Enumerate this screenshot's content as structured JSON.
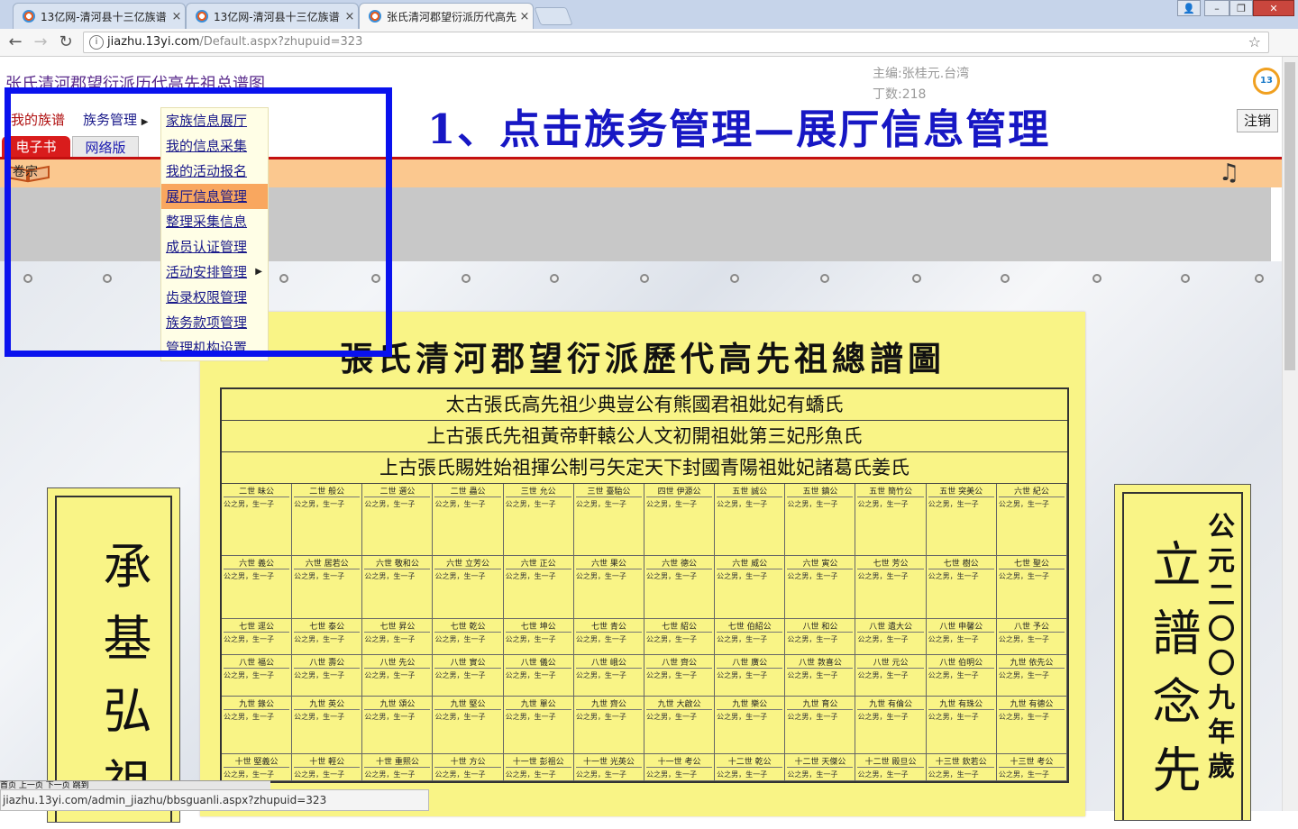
{
  "browser": {
    "tabs": [
      {
        "title": "13亿网-清河县十三亿族谱"
      },
      {
        "title": "13亿网-清河县十三亿族谱"
      },
      {
        "title": "张氏清河郡望衍派历代高先"
      }
    ],
    "tab_close": "×",
    "window_buttons": [
      "👤",
      "–",
      "❐",
      "✕"
    ],
    "address": {
      "host": "jiazhu.13yi.com",
      "path": "/Default.aspx?zhupuid=323"
    },
    "status_url": "jiazhu.13yi.com/admin_jiazhu/bbsguanli.aspx?zhupuid=323"
  },
  "page": {
    "site_title": "张氏清河郡望衍派历代高先祖总谱图",
    "editor": "主编:张桂元.台湾",
    "ding": "丁数:218",
    "logo_text": "13",
    "logout": "注销",
    "heading": "1、点击族务管理—展厅信息管理",
    "menu": {
      "my_clan": "我的族谱",
      "clan_affairs": "族务管理"
    },
    "tabs": {
      "ebook": "电子书",
      "web": "网络版"
    },
    "tiao_label": "卷宗",
    "dropdown": [
      "家族信息展厅",
      "我的信息采集",
      "我的活动报名",
      "展厅信息管理",
      "整理采集信息",
      "成员认证管理",
      "活动安排管理",
      "齿录权限管理",
      "族务款项管理",
      "管理机构设置"
    ],
    "dropdown_selected": 3,
    "pager": "首页 上一页 下一页 跳到"
  },
  "poster": {
    "title": "張氏清河郡望衍派歷代高先祖總譜圖",
    "banners": [
      "太古張氏高先祖少典豈公有熊國君祖妣妃有蟜氏",
      "上古張氏先祖黃帝軒轅公人文初開祖妣第三妃彤魚氏",
      "上古張氏賜姓始祖揮公制弓矢定天下封國青陽祖妣妃諸葛氏姜氏"
    ],
    "rows": [
      [
        "二世 昧公",
        "二世 般公",
        "二世 選公",
        "二世 蟲公",
        "三世 允公",
        "三世 臺駘公",
        "四世 伊源公",
        "五世 誠公",
        "五世 鎮公",
        "五世 簡竹公",
        "五世 突美公",
        "六世 紀公"
      ],
      [
        "六世 義公",
        "六世 居若公",
        "六世 敬和公",
        "六世 立芳公",
        "六世 正公",
        "六世 果公",
        "六世 德公",
        "六世 威公",
        "六世 寅公",
        "七世 芳公",
        "七世 樹公",
        "七世 聖公"
      ],
      [
        "七世 逕公",
        "七世 泰公",
        "七世 昇公",
        "七世 乾公",
        "七世 坤公",
        "七世 青公",
        "七世 紹公",
        "七世 伯紹公",
        "八世 和公",
        "八世 遺大公",
        "八世 申馨公",
        "八世 予公"
      ],
      [
        "八世 福公",
        "八世 壽公",
        "八世 先公",
        "八世 實公",
        "八世 儀公",
        "八世 峨公",
        "八世 齊公",
        "八世 廣公",
        "八世 敦喜公",
        "八世 元公",
        "八世 伯明公",
        "九世 依先公"
      ],
      [
        "九世 錄公",
        "九世 英公",
        "九世 頌公",
        "九世 堅公",
        "九世 單公",
        "九世 齊公",
        "九世 大啟公",
        "九世 樂公",
        "九世 育公",
        "九世 有倫公",
        "九世 有珠公",
        "九世 有德公"
      ],
      [
        "十世 堅義公",
        "十世 輕公",
        "十世 重熙公",
        "十世 方公",
        "十一世 彭祖公",
        "十一世 光英公",
        "十一世 考公",
        "十二世 乾公",
        "十二世 天傑公",
        "十二世 殿旦公",
        "十三世 欽若公",
        "十三世 考公"
      ]
    ],
    "desc_sample": "公之男，生一子",
    "left_scroll_text": "承基弘祖",
    "right_scroll_text": "立譜念先",
    "right_scroll_date": "公元二〇〇九年歲"
  }
}
